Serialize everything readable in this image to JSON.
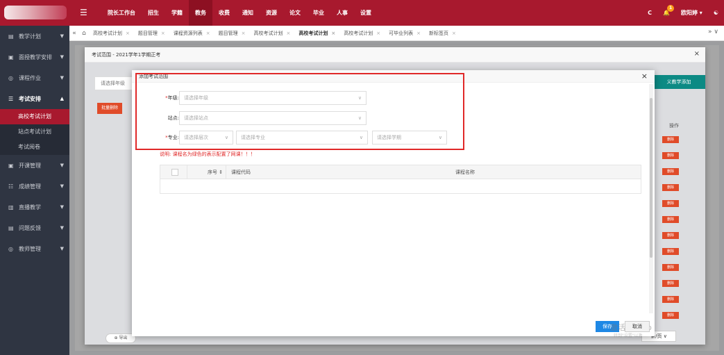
{
  "topbar": {
    "nav": [
      "院长工作台",
      "招生",
      "学籍",
      "教务",
      "收费",
      "通知",
      "资源",
      "论文",
      "毕业",
      "人事",
      "设置"
    ],
    "active_nav": 3,
    "user": "欧阳婷",
    "badge": "1"
  },
  "sidebar": {
    "items": [
      {
        "label": "教学计划",
        "icon": "plan-icon"
      },
      {
        "label": "面授教学安排",
        "icon": "schedule-icon"
      },
      {
        "label": "课程作业",
        "icon": "homework-icon"
      },
      {
        "label": "考试安排",
        "icon": "exam-icon",
        "open": true
      },
      {
        "label": "开课管理",
        "icon": "course-icon"
      },
      {
        "label": "成绩管理",
        "icon": "score-icon"
      },
      {
        "label": "直播教学",
        "icon": "live-icon"
      },
      {
        "label": "问题反馈",
        "icon": "feedback-icon"
      },
      {
        "label": "教师管理",
        "icon": "teacher-icon"
      }
    ],
    "subitems": [
      "高校考试计划",
      "站点考试计划",
      "考试阅卷"
    ]
  },
  "tabs": [
    {
      "label": "高校考试计划"
    },
    {
      "label": "题目管理"
    },
    {
      "label": "课程资源列表"
    },
    {
      "label": "题目管理"
    },
    {
      "label": "高校考试计划"
    },
    {
      "label": "高校考试计划",
      "active": true
    },
    {
      "label": "高校考试计划"
    },
    {
      "label": "可毕业列表"
    },
    {
      "label": "新标签页"
    }
  ],
  "background": {
    "select_placeholder": "请选择年级",
    "delete_label": "批量删除",
    "custom_button": "义教学添加",
    "ops_header": "操作",
    "op_label": "删除",
    "export_label": "导出",
    "pager": "条/页"
  },
  "dialog1": {
    "title": "考试范围 - 2021学年1学期正考"
  },
  "dialog2": {
    "title": "添加考试范围",
    "grade_label": "年级:",
    "grade_placeholder": "请选择年级",
    "site_label": "站点:",
    "site_placeholder": "请选择站点",
    "major_label": "专业:",
    "level_placeholder": "请选择层次",
    "major_placeholder": "请选择专业",
    "term_placeholder": "请选择学期",
    "note": "说明: 课程名为绿色的表示配置了网课！！！",
    "col_seq": "序号",
    "col_code": "课程代码",
    "col_name": "课程名称"
  },
  "footer": {
    "save": "保存",
    "cancel": "取消",
    "watermark": "激活 Windo",
    "watermark2": "转到\"设置\"以激"
  }
}
